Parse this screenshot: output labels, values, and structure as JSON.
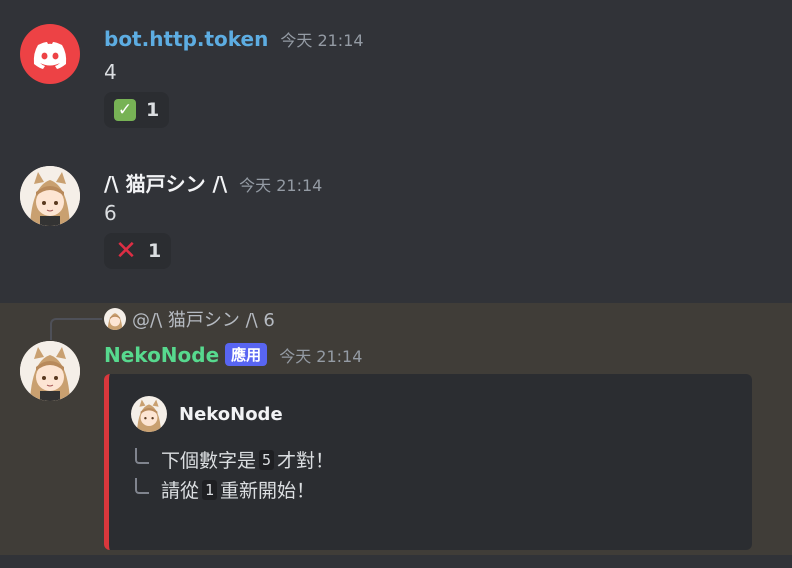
{
  "messages": [
    {
      "username": "bot.http.token",
      "username_color": "#5dade2",
      "time": "今天 21:14",
      "content": "4",
      "reaction": {
        "emoji": "check-mark-button",
        "count": "1"
      },
      "avatar_icon": "discord-logo-icon"
    },
    {
      "username": "/\\ 猫戸シン /\\",
      "username_color": "#f2f3f5",
      "time": "今天 21:14",
      "content": "6",
      "reaction": {
        "emoji": "cross-mark",
        "count": "1"
      },
      "avatar_icon": "anime-cat-girl-avatar"
    }
  ],
  "reply": {
    "reference_text": "@/\\ 猫戸シン /\\ 6",
    "username": "NekoNode",
    "username_color": "#57d98e",
    "bot_tag": "應用",
    "time": "今天 21:14",
    "embed": {
      "accent_color": "#da373c",
      "author": "NekoNode",
      "line1_pre": "下個數字是",
      "line1_code": "5",
      "line1_post": "才對！",
      "line2_pre": "請從",
      "line2_code": "1",
      "line2_post": "重新開始！"
    }
  },
  "colors": {
    "background": "#313338",
    "highlight": "#403d38",
    "bot_tag": "#5865f2",
    "discord_red": "#ed4245"
  }
}
